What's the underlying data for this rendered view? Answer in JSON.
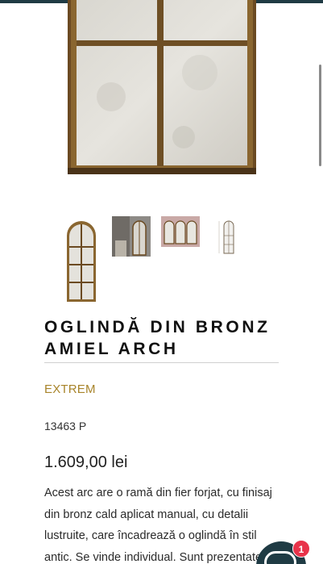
{
  "product": {
    "title_line1": "OGLINDĂ DIN BRONZ",
    "title_line2": "AMIEL ARCH",
    "brand": "EXTREM",
    "sku": "13463 P",
    "price": "1.609,00 lei",
    "description": "Acest arc are o ramă din fier forjat, cu finisaj din bronz cald aplicat manual, cu detalii lustruite, care încadrează o oglindă în stil antic. Se vinde individual. Sunt prezentate"
  },
  "gallery": {
    "thumbnails": [
      "mirror-arch-front",
      "mirror-in-room",
      "three-mirrors-set",
      "mirror-dimension-drawing"
    ]
  },
  "chat": {
    "badge_count": "1"
  },
  "colors": {
    "accent_dark": "#1f3b44",
    "brand_gold": "#a8842a",
    "badge_red": "#e8334a"
  }
}
